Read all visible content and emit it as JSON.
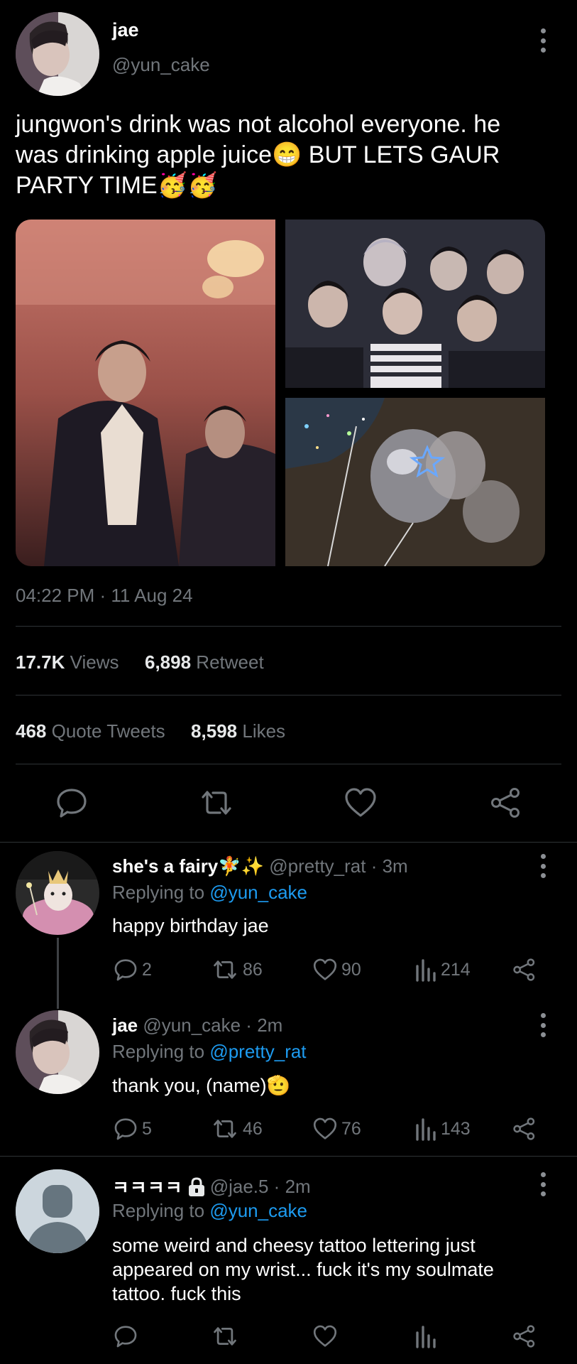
{
  "main_tweet": {
    "display_name": "jae",
    "handle": "@yun_cake",
    "text_line1": "jungwon's drink was not alcohol everyone. he",
    "text_line2_a": "was drinking apple juice",
    "text_line2_emoji": "😁",
    "text_line2_b": " BUT LETS GAUR",
    "text_line3_a": "PARTY TIME",
    "text_line3_emoji": "🥳🥳",
    "timestamp": "04:22 PM · 11 Aug 24",
    "views_count": "17.7K",
    "views_label": "Views",
    "retweet_count": "6,898",
    "retweet_label": "Retweet",
    "quote_count": "468",
    "quote_label": "Quote Tweets",
    "likes_count": "8,598",
    "likes_label": "Likes"
  },
  "replies": [
    {
      "display_name": "she's a fairy",
      "name_emoji": "🧚✨",
      "handle_time": "@pretty_rat · 3m",
      "replying_label": "Replying to ",
      "replying_to": "@yun_cake",
      "text": "happy birthday jae",
      "replies": "2",
      "retweets": "86",
      "likes": "90",
      "views": "214"
    },
    {
      "display_name": "jae",
      "handle_time": "@yun_cake · 2m",
      "replying_label": "Replying to ",
      "replying_to": "@pretty_rat",
      "text": "thank you, (name)",
      "text_emoji": "🫡",
      "replies": "5",
      "retweets": "46",
      "likes": "76",
      "views": "143"
    },
    {
      "display_name": "ㅋㅋㅋㅋ",
      "name_icon": "lock-icon",
      "handle_time": "@jae.5 · 2m",
      "replying_label": "Replying to ",
      "replying_to": "@yun_cake",
      "text_line1": "some weird and cheesy tattoo lettering just",
      "text_line2": "appeared on my wrist... fuck it's my soulmate",
      "text_line3": "tattoo. fuck this"
    }
  ],
  "colors": {
    "background": "#000000",
    "text": "#e7e9ea",
    "secondary": "#71767b",
    "link": "#1d9bf0",
    "divider": "#2f3336"
  }
}
